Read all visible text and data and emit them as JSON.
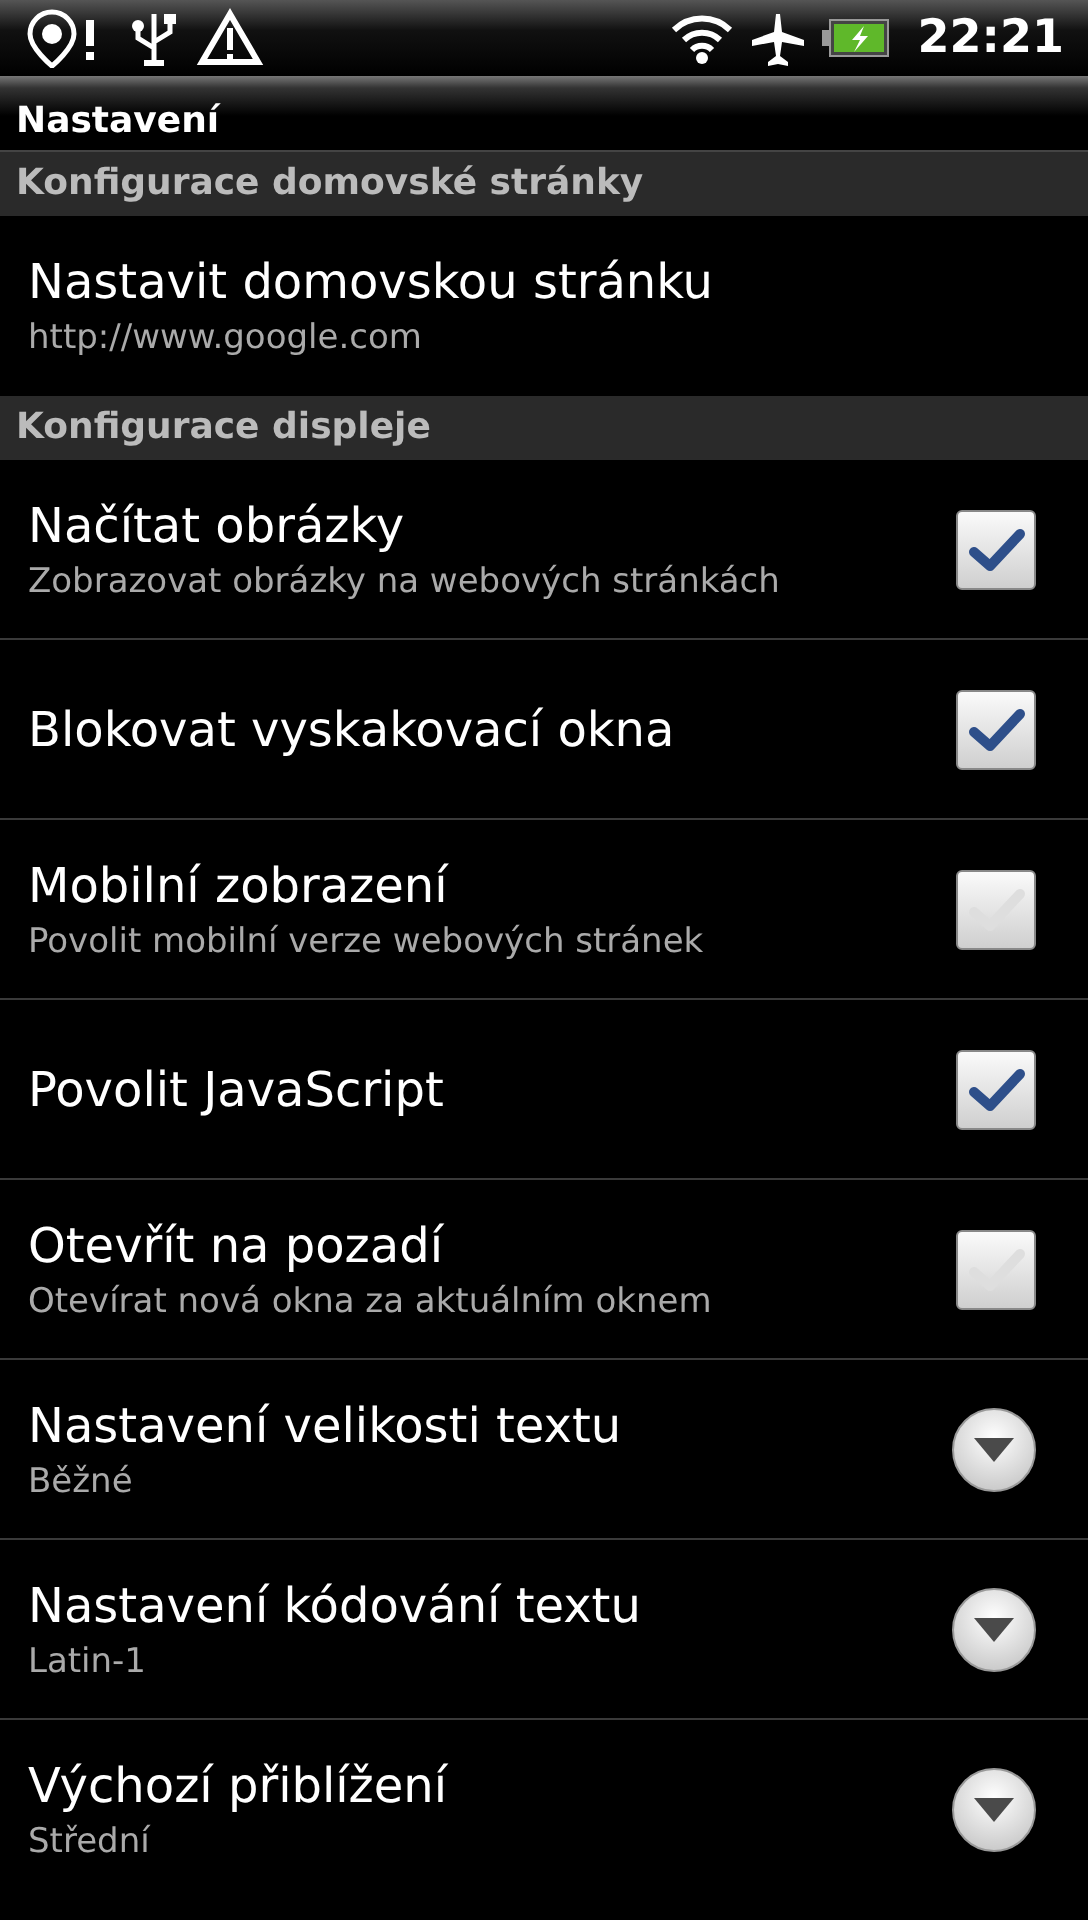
{
  "status_bar": {
    "time": "22:21"
  },
  "title": "Nastavení",
  "sections": [
    {
      "header": "Konfigurace domovské stránky",
      "items": [
        {
          "kind": "text",
          "title": "Nastavit domovskou stránku",
          "summary": "http://www.google.com"
        }
      ]
    },
    {
      "header": "Konfigurace displeje",
      "items": [
        {
          "kind": "checkbox",
          "title": "Načítat obrázky",
          "summary": "Zobrazovat obrázky na webových stránkách",
          "checked": true
        },
        {
          "kind": "checkbox",
          "title": "Blokovat vyskakovací okna",
          "checked": true
        },
        {
          "kind": "checkbox",
          "title": "Mobilní zobrazení",
          "summary": "Povolit mobilní verze webových stránek",
          "checked": false
        },
        {
          "kind": "checkbox",
          "title": "Povolit JavaScript",
          "checked": true
        },
        {
          "kind": "checkbox",
          "title": "Otevřít na pozadí",
          "summary": "Otevírat nová okna za aktuálním oknem",
          "checked": false
        },
        {
          "kind": "list",
          "title": "Nastavení velikosti textu",
          "summary": "Běžné"
        },
        {
          "kind": "list",
          "title": "Nastavení kódování textu",
          "summary": "Latin-1"
        },
        {
          "kind": "list",
          "title": "Výchozí přiblížení",
          "summary": "Střední"
        }
      ]
    }
  ]
}
